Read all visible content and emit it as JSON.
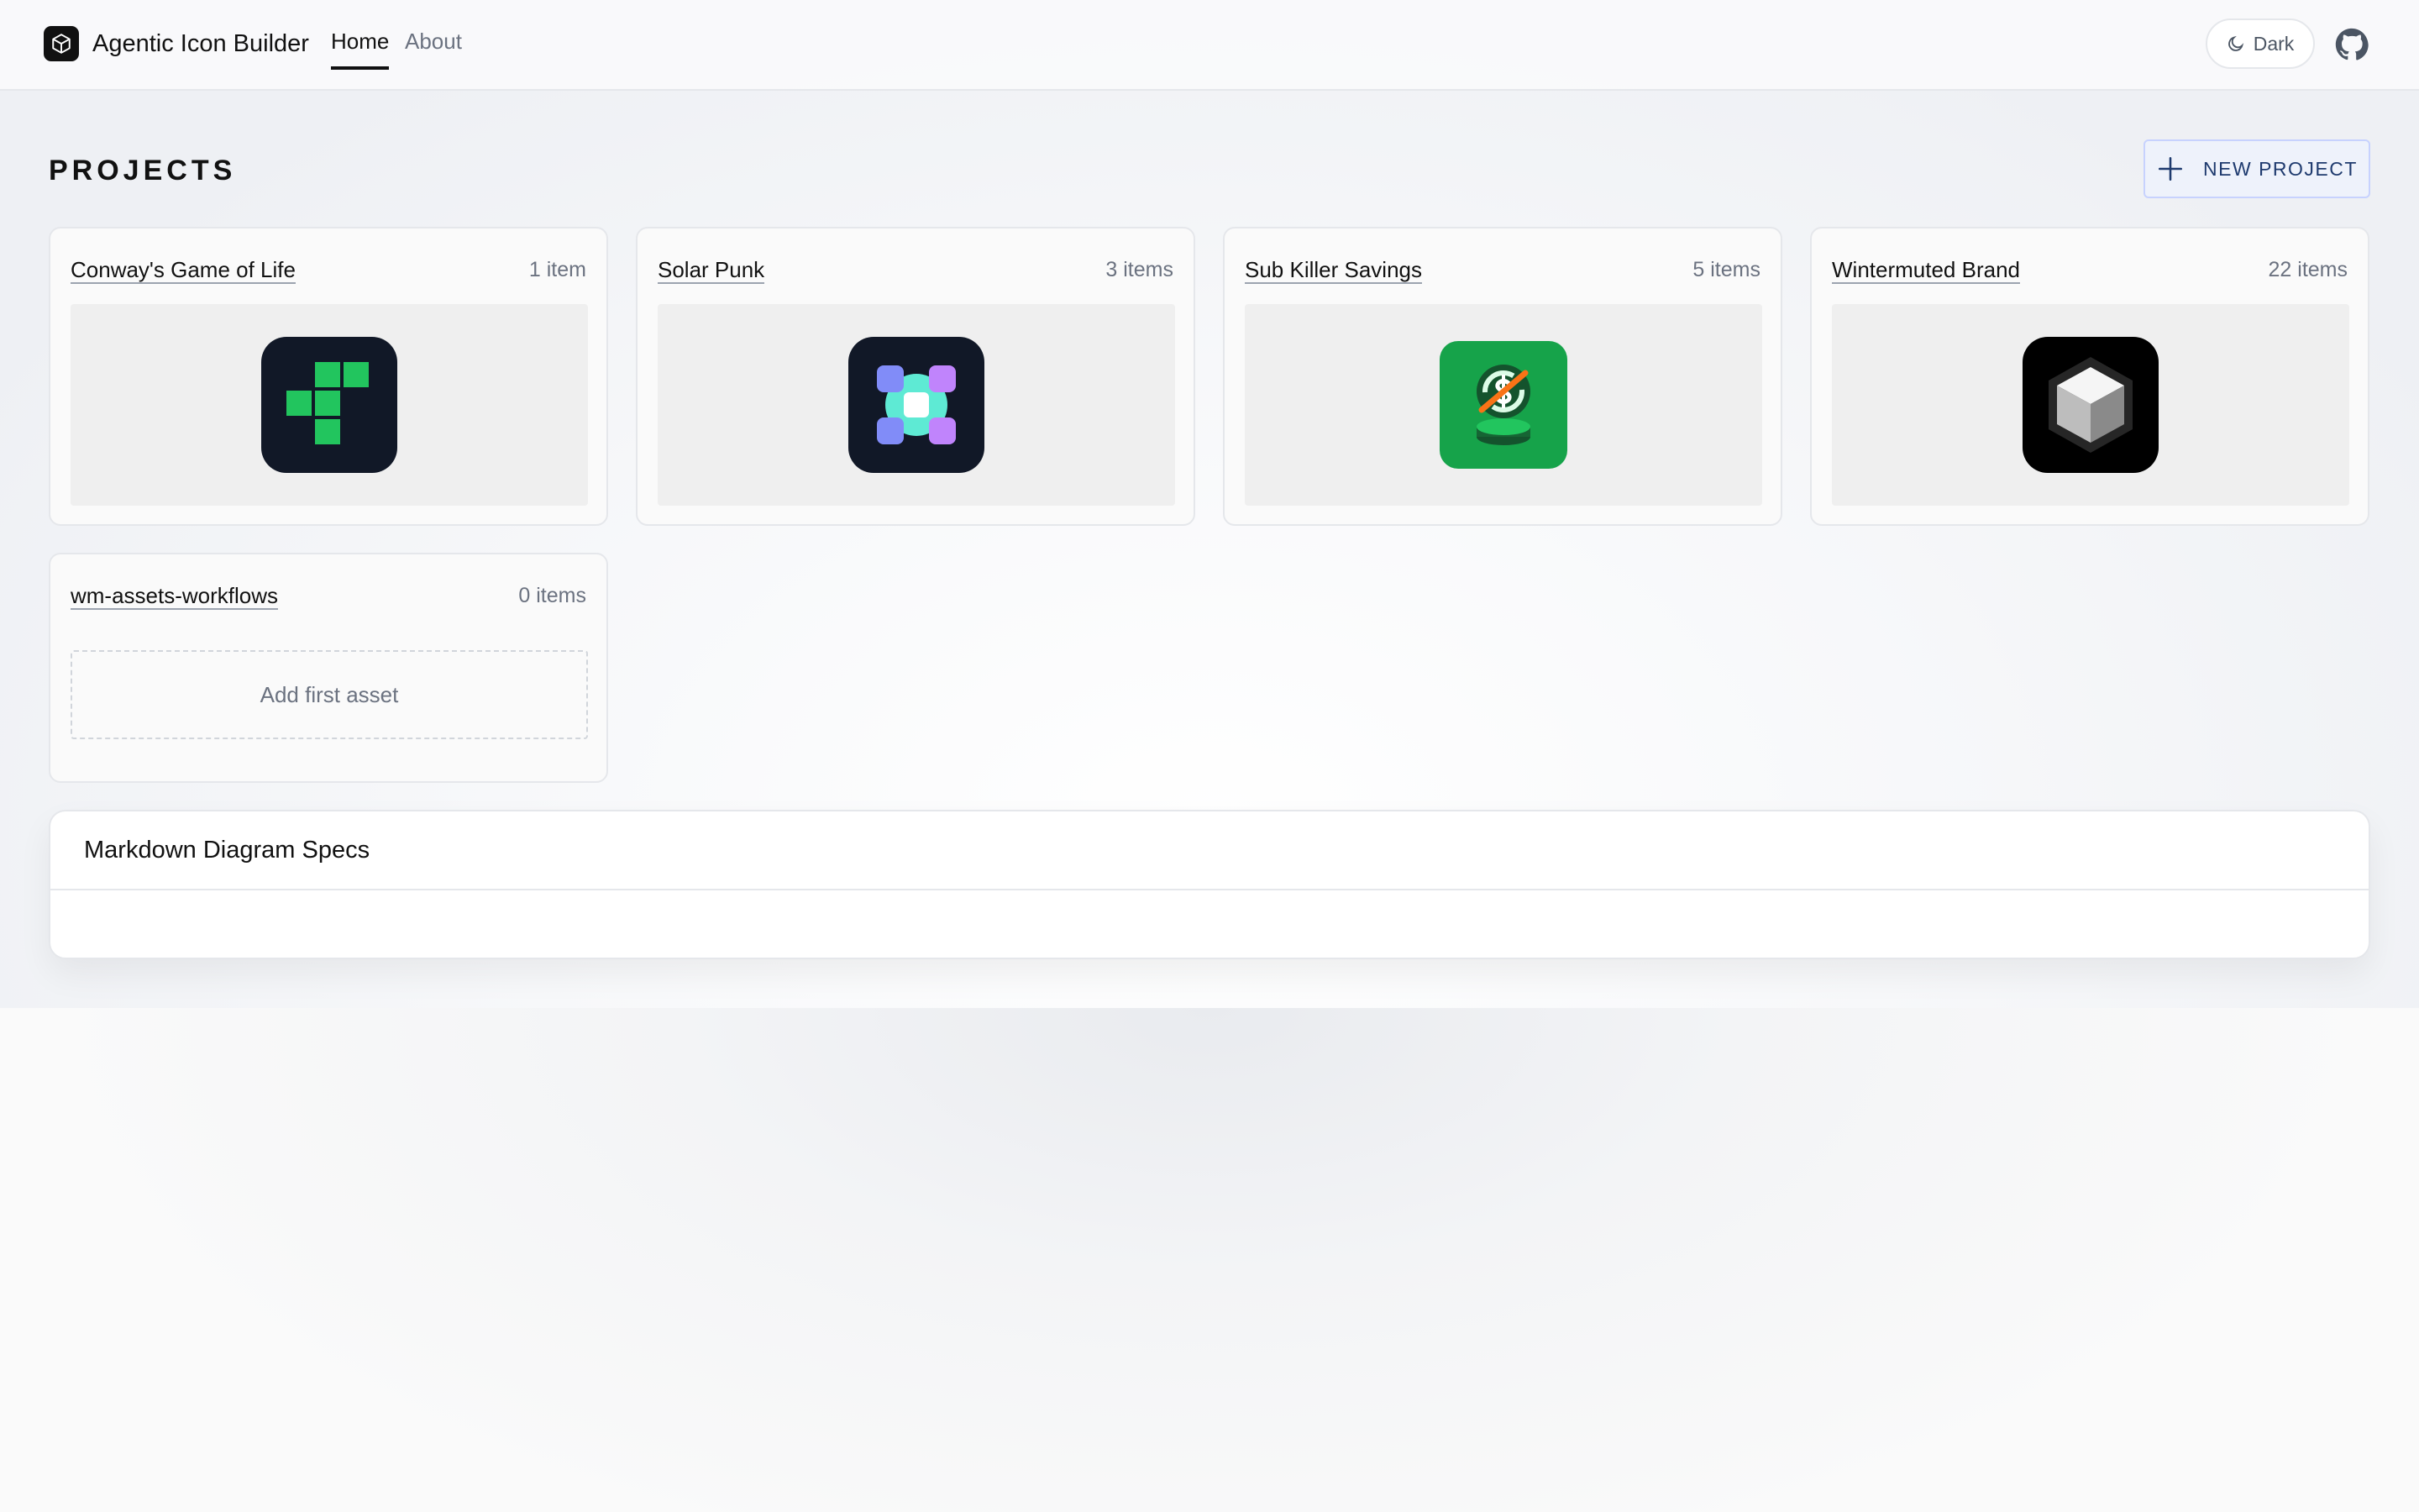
{
  "header": {
    "app_title": "Agentic Icon Builder",
    "nav": {
      "home": "Home",
      "about": "About"
    },
    "theme_toggle": "Dark"
  },
  "projects": {
    "heading": "PROJECTS",
    "new_project_label": "NEW PROJECT",
    "cards": [
      {
        "title": "Conway's Game of Life",
        "count": "1 item",
        "icon": "game-of-life-icon",
        "tile_color": "#111827",
        "accent": "#22c55e"
      },
      {
        "title": "Solar Punk",
        "count": "3 items",
        "icon": "solar-punk-icon",
        "tile_color": "#111827",
        "accent": "#5eead4"
      },
      {
        "title": "Sub Killer Savings",
        "count": "5 items",
        "icon": "savings-coin-icon",
        "tile_color": "#16a34a",
        "accent": "#f97316"
      },
      {
        "title": "Wintermuted Brand",
        "count": "22 items",
        "icon": "cube-icon",
        "tile_color": "#000000",
        "accent": "#e5e7eb"
      },
      {
        "title": "wm-assets-workflows",
        "count": "0 items",
        "empty_label": "Add first asset"
      }
    ]
  },
  "markdown_panel": {
    "title": "Markdown Diagram Specs"
  }
}
